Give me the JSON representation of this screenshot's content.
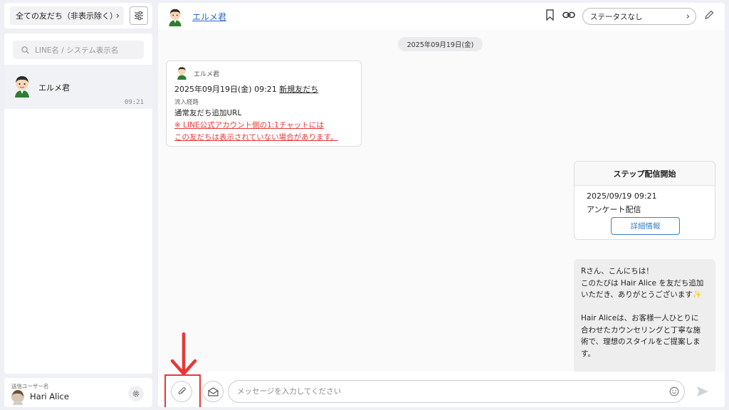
{
  "sidebar": {
    "filter_label": "全ての友だち（非表示除く）",
    "search_placeholder": "LINE名 / システム表示名",
    "friends": [
      {
        "name": "エルメ君",
        "time": "09:21"
      }
    ],
    "sender": {
      "caption": "送信ユーザー名",
      "name": "Hari Alice"
    }
  },
  "chat": {
    "header": {
      "name": "エルメ君",
      "status": "ステータスなし"
    },
    "date_separator": "2025年09月19日(金)",
    "system_card": {
      "sender": "エルメ君",
      "datetime": "2025年09月19日(金) 09:21",
      "event": "新規友だち",
      "route_caption": "流入経路",
      "route": "通常友だち追加URL",
      "warning_line1": "※ LINE公式アカウント側の1:1チャットには",
      "warning_line2": "この友だちは表示されていない場合があります。"
    },
    "step_card": {
      "title": "ステップ配信開始",
      "datetime": "2025/09/19 09:21",
      "name": "アンケート配信",
      "detail_button": "詳細情報"
    },
    "message": {
      "lines": [
        "Rさん、こんにちは！",
        "このたびは Hair Alice を友だち追加",
        "いただき、ありがとうございます",
        "",
        "Hair Aliceは、お客様一人ひとりに",
        "合わせたカウンセリングと丁寧な施",
        "術で、理想のスタイルをご提案しま",
        "す。"
      ],
      "sparkle": "✨"
    },
    "composer": {
      "placeholder": "メッセージを入力してください"
    }
  },
  "colors": {
    "accent": "#2a67c8",
    "warning": "#e53935",
    "annotation": "#e53935"
  },
  "icons": [
    "settings-sliders-icon",
    "search-icon",
    "gear-icon",
    "bookmark-icon",
    "link-icon",
    "chevron-right-icon",
    "pencil-icon",
    "paperclip-icon",
    "envelope-icon",
    "emoji-icon",
    "send-icon",
    "arrow-down-icon"
  ]
}
